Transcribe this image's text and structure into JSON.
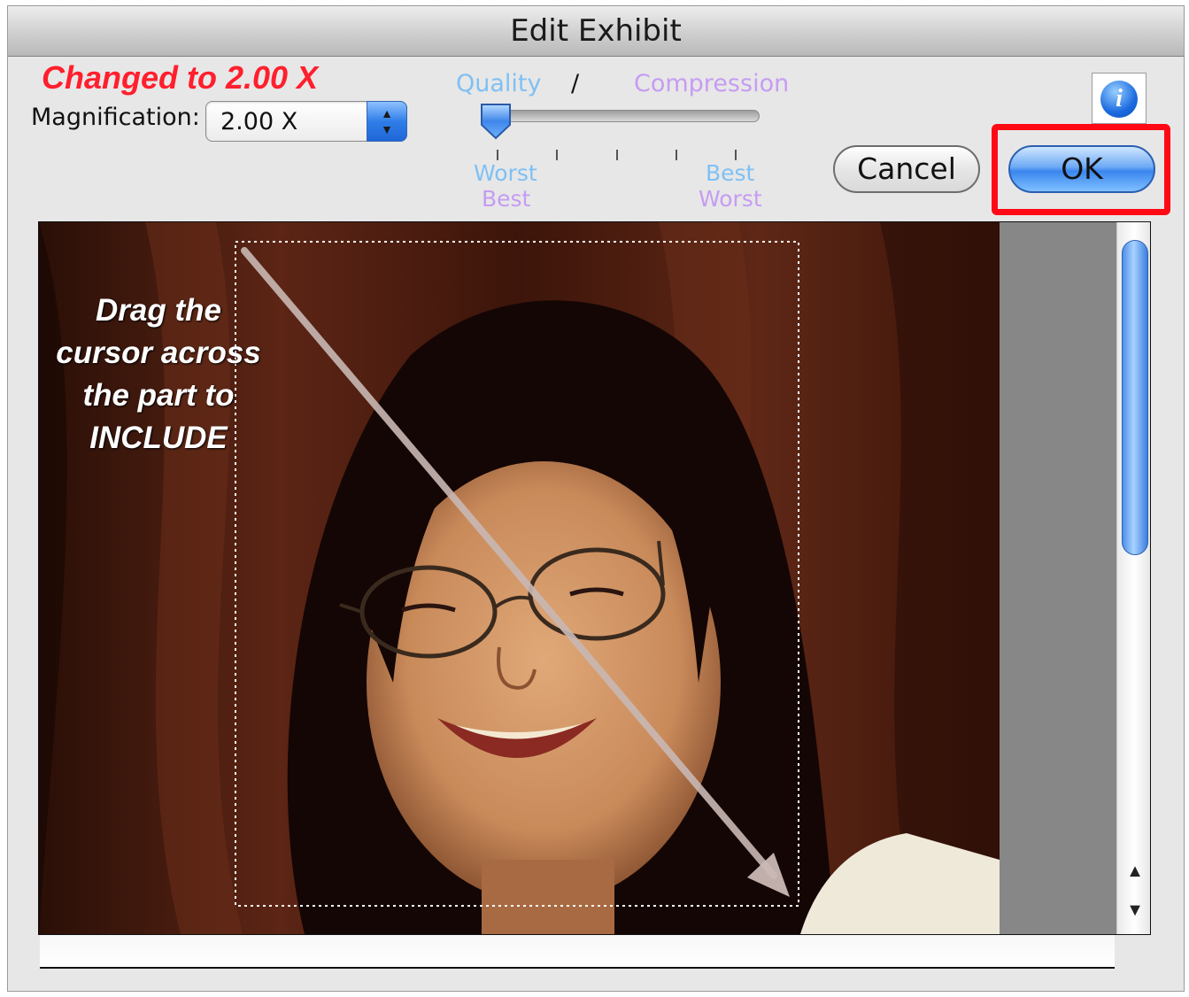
{
  "window": {
    "title": "Edit Exhibit"
  },
  "annotation": {
    "text": "Changed to 2.00 X",
    "color": "#ff1f2d",
    "highlight_color": "#ff0a14"
  },
  "magnification": {
    "label": "Magnification:",
    "value": "2.00 X",
    "arrow_up": "▲",
    "arrow_down": "▼"
  },
  "quality_slider": {
    "quality_label": "Quality",
    "separator": "/",
    "compression_label": "Compression",
    "quality_color": "#7fc0f4",
    "compression_color": "#c69cf2",
    "left_quality": "Worst",
    "left_compression": "Best",
    "right_quality": "Best",
    "right_compression": "Worst",
    "value_fraction": 0.0,
    "ticks": 5
  },
  "buttons": {
    "info": "i",
    "cancel": "Cancel",
    "ok": "OK"
  },
  "preview": {
    "instruction": "Drag the\ncursor across\nthe part to\nINCLUDE",
    "scroll_up": "▲",
    "scroll_down": "▼"
  }
}
